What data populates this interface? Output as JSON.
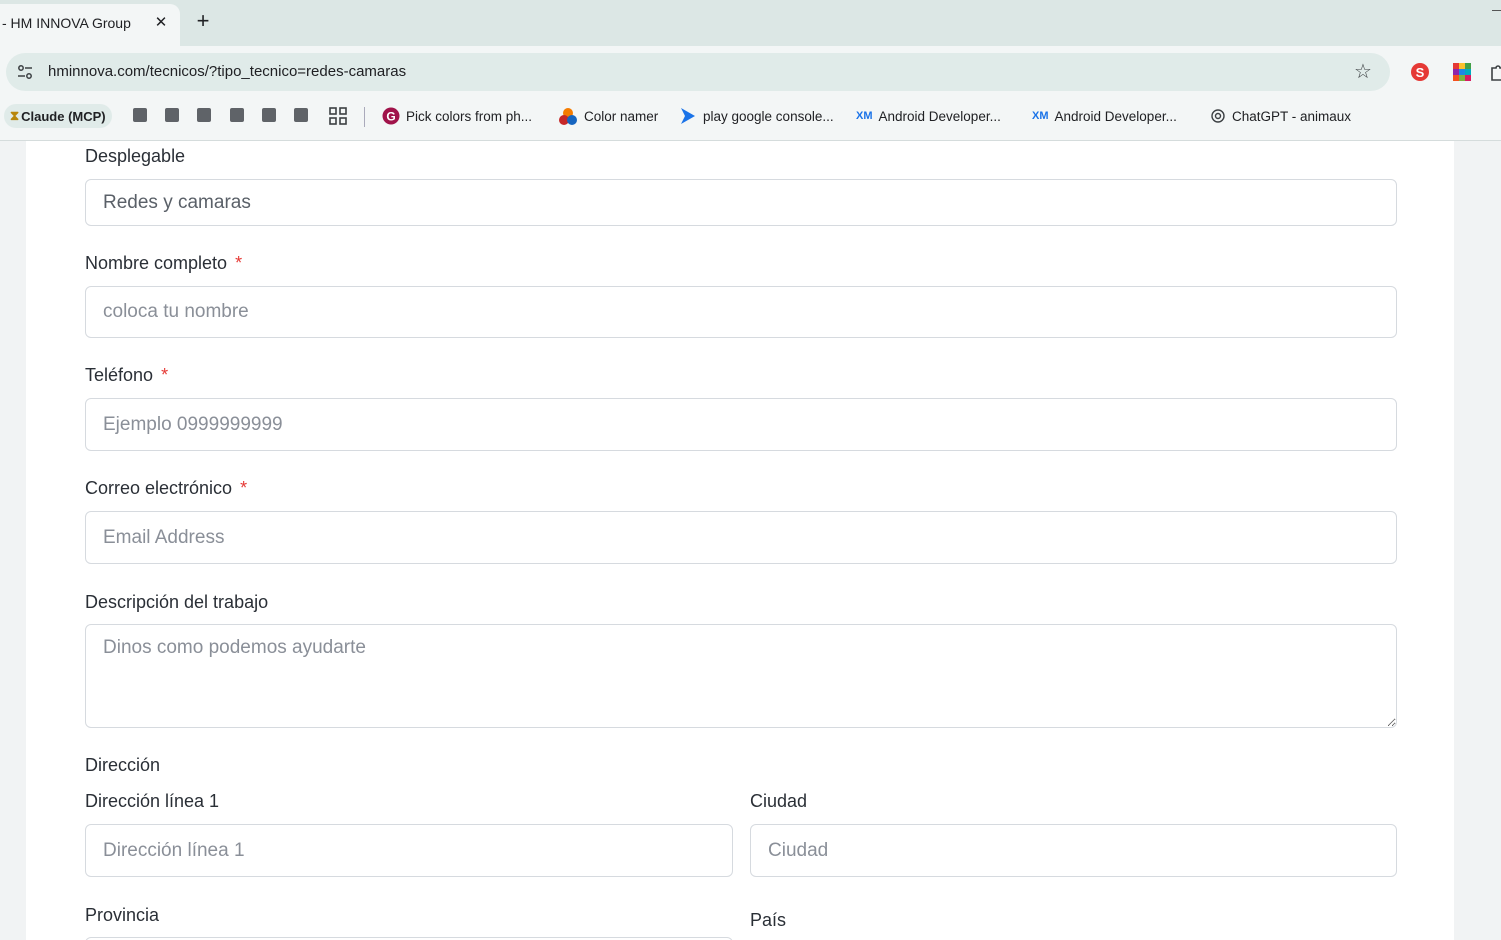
{
  "browser": {
    "tab_title": "- HM INNOVA Group",
    "tab_close": "✕",
    "new_tab": "+",
    "url": "hminnova.com/tecnicos/?tipo_tecnico=redes-camaras",
    "bookmarks": [
      {
        "label": "Claude (MCP)",
        "icon": "hourglass-icon"
      },
      {
        "label": "Pick colors from ph...",
        "icon": "g-logo-icon"
      },
      {
        "label": "Color namer",
        "icon": "color-namer-icon"
      },
      {
        "label": "play google console...",
        "icon": "play-console-icon"
      },
      {
        "label": "Android Developer...",
        "icon": "xm-icon"
      },
      {
        "label": "Android Developer...",
        "icon": "xm-icon"
      },
      {
        "label": "ChatGPT - animaux",
        "icon": "openai-icon"
      }
    ]
  },
  "form": {
    "dropdown": {
      "label": "Desplegable",
      "value": "Redes y camaras"
    },
    "name": {
      "label": "Nombre completo",
      "required": "*",
      "placeholder": "coloca tu nombre"
    },
    "phone": {
      "label": "Teléfono",
      "required": "*",
      "placeholder": "Ejemplo 0999999999"
    },
    "email": {
      "label": "Correo electrónico",
      "required": "*",
      "placeholder": "Email Address"
    },
    "description": {
      "label": "Descripción del trabajo",
      "placeholder": "Dinos como podemos ayudarte"
    },
    "address": {
      "section_label": "Dirección",
      "line1": {
        "label": "Dirección línea 1",
        "placeholder": "Dirección línea 1"
      },
      "city": {
        "label": "Ciudad",
        "placeholder": "Ciudad"
      },
      "province": {
        "label": "Provincia"
      },
      "country": {
        "label": "País"
      }
    }
  },
  "colors": {
    "required": "#e53935",
    "tabstrip": "#dce7e5",
    "omnibox": "#e0ebe9"
  }
}
